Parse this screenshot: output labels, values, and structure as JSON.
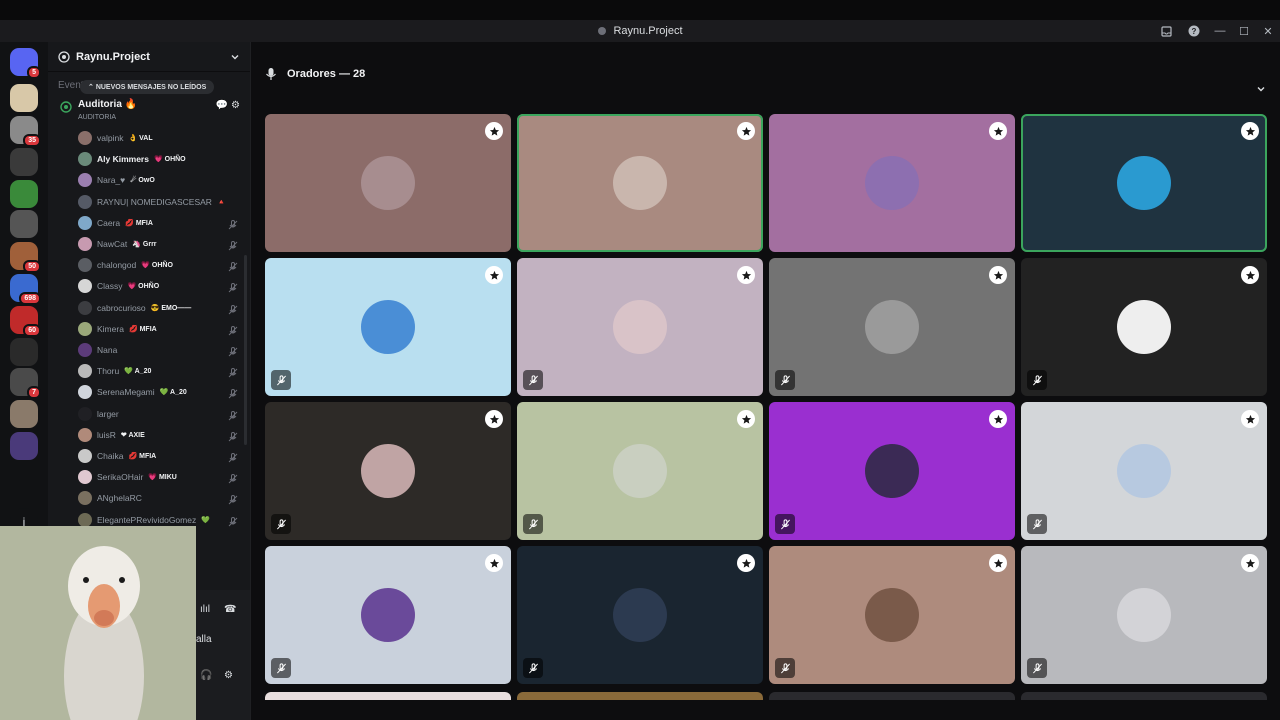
{
  "window": {
    "title": "Raynu.Project"
  },
  "server": {
    "name": "Raynu.Project"
  },
  "unread_pill": "NUEVOS MENSAJES NO LEÍDOS",
  "faded_channel": "Eventos Mientras M...",
  "channel": {
    "name": "Auditoria 🔥",
    "sub": "AUDITORIA"
  },
  "members": [
    {
      "name": "valpink",
      "tag": "👌 VAL",
      "bright": false,
      "muted": false,
      "color": "#8a6f6a"
    },
    {
      "name": "Aly Kimmers",
      "tag": "💗 OHÑO",
      "bright": true,
      "muted": false,
      "color": "#6a8a7a"
    },
    {
      "name": "Nara_♥",
      "tag": "☄ OwO",
      "bright": false,
      "muted": false,
      "color": "#9b7fb0"
    },
    {
      "name": "RAYNU| NOMEDIGASCESAR",
      "tag": "🔺",
      "bright": false,
      "muted": false,
      "color": "#555a66"
    },
    {
      "name": "Caera",
      "tag": "💋 MFIA",
      "bright": false,
      "muted": true,
      "color": "#7fa8c9"
    },
    {
      "name": "NawCat",
      "tag": "🦄 Grrr",
      "bright": false,
      "muted": true,
      "color": "#c79ab0"
    },
    {
      "name": "chalongod",
      "tag": "💗 OHÑO",
      "bright": false,
      "muted": true,
      "color": "#5a5d63"
    },
    {
      "name": "Classy",
      "tag": "💗 OHÑO",
      "bright": false,
      "muted": true,
      "color": "#d6d6d6"
    },
    {
      "name": "cabrocurioso",
      "tag": "😎 EMO——",
      "bright": false,
      "muted": true,
      "color": "#3c3d41"
    },
    {
      "name": "Kimera",
      "tag": "💋 MFIA",
      "bright": false,
      "muted": true,
      "color": "#9aa87a"
    },
    {
      "name": "Nana",
      "tag": "",
      "bright": false,
      "muted": true,
      "color": "#5c3b7a"
    },
    {
      "name": "Thoru",
      "tag": "💚 A_20",
      "bright": false,
      "muted": true,
      "color": "#b9b9b9"
    },
    {
      "name": "SerenaMegami",
      "tag": "💚 A_20",
      "bright": false,
      "muted": true,
      "color": "#d0d4dc"
    },
    {
      "name": "larger",
      "tag": "",
      "bright": false,
      "muted": true,
      "color": "#202024"
    },
    {
      "name": "luisR",
      "tag": "❤ AXIE",
      "bright": false,
      "muted": true,
      "color": "#b08a7a"
    },
    {
      "name": "Chaika",
      "tag": "💋 MFIA",
      "bright": false,
      "muted": true,
      "color": "#c9c9c9"
    },
    {
      "name": "SerikaOHair",
      "tag": "💗 MIKU",
      "bright": false,
      "muted": true,
      "color": "#e0c8d0"
    },
    {
      "name": "ANghelaRC",
      "tag": "",
      "bright": false,
      "muted": true,
      "color": "#7a7060"
    },
    {
      "name": "ElegantePRevividoGomez",
      "tag": "💚",
      "bright": false,
      "muted": true,
      "color": "#6d6a55"
    }
  ],
  "stage": {
    "label": "Oradores — 28"
  },
  "tiles": [
    {
      "bg": "#8c6c69",
      "avatar": "#a78d8f",
      "speaking": false,
      "muted": false
    },
    {
      "bg": "#a98a80",
      "avatar": "#c9b6ad",
      "speaking": true,
      "muted": false
    },
    {
      "bg": "#a36fa0",
      "avatar": "#8d6fb0",
      "speaking": false,
      "muted": false
    },
    {
      "bg": "#1f3340",
      "avatar": "#2a9ad0",
      "speaking": true,
      "muted": false
    },
    {
      "bg": "#b9dff0",
      "avatar": "#4a8ed6",
      "speaking": false,
      "muted": true
    },
    {
      "bg": "#c2b2c1",
      "avatar": "#d9c3c8",
      "speaking": false,
      "muted": true
    },
    {
      "bg": "#737373",
      "avatar": "#9a9a9a",
      "speaking": false,
      "muted": true
    },
    {
      "bg": "#222222",
      "avatar": "#eeeeee",
      "speaking": false,
      "muted": true
    },
    {
      "bg": "#2d2a27",
      "avatar": "#c0a4a4",
      "speaking": false,
      "muted": true
    },
    {
      "bg": "#b8c3a2",
      "avatar": "#c9cfc0",
      "speaking": false,
      "muted": true
    },
    {
      "bg": "#9a2fd0",
      "avatar": "#3b2a55",
      "speaking": false,
      "muted": true
    },
    {
      "bg": "#d3d6d9",
      "avatar": "#b7c9e0",
      "speaking": false,
      "muted": true
    },
    {
      "bg": "#c9d1dc",
      "avatar": "#6a4a9a",
      "speaking": false,
      "muted": true
    },
    {
      "bg": "#1a2530",
      "avatar": "#2c3a50",
      "speaking": false,
      "muted": true
    },
    {
      "bg": "#ae8b7d",
      "avatar": "#7a5a4a",
      "speaking": false,
      "muted": true
    },
    {
      "bg": "#b8b9bd",
      "avatar": "#d3d3d7",
      "speaking": false,
      "muted": true
    }
  ],
  "row5_colors": [
    "#e8dede",
    "#8a6a3a",
    "#2a2a2e",
    "#2a2a2e"
  ],
  "server_rail": [
    {
      "color": "#5865f2",
      "badge": "5",
      "icon": "discord-icon"
    },
    {
      "color": "#d8c8a8",
      "badge": "",
      "icon": "server-icon"
    },
    {
      "color": "#8a8a8a",
      "badge": "35",
      "icon": "server-icon"
    },
    {
      "color": "#3a3a3a",
      "badge": "",
      "icon": "server-icon"
    },
    {
      "color": "#3a8a3a",
      "badge": "",
      "icon": "server-icon"
    },
    {
      "color": "#555555",
      "badge": "",
      "icon": "server-icon"
    },
    {
      "color": "#a0603a",
      "badge": "50",
      "icon": "server-icon"
    },
    {
      "color": "#3a6ad0",
      "badge": "698",
      "icon": "server-icon"
    },
    {
      "color": "#c02a2a",
      "badge": "60",
      "icon": "server-icon"
    },
    {
      "color": "#2a2a2a",
      "badge": "",
      "icon": "server-icon"
    },
    {
      "color": "#4a4a4a",
      "badge": "7",
      "icon": "server-icon"
    },
    {
      "color": "#8a7a6a",
      "badge": "",
      "icon": "server-icon"
    },
    {
      "color": "#4a3a7a",
      "badge": "",
      "icon": "server-icon"
    }
  ],
  "rail_letter": "j",
  "bottom_panel": {
    "label": "alla"
  }
}
